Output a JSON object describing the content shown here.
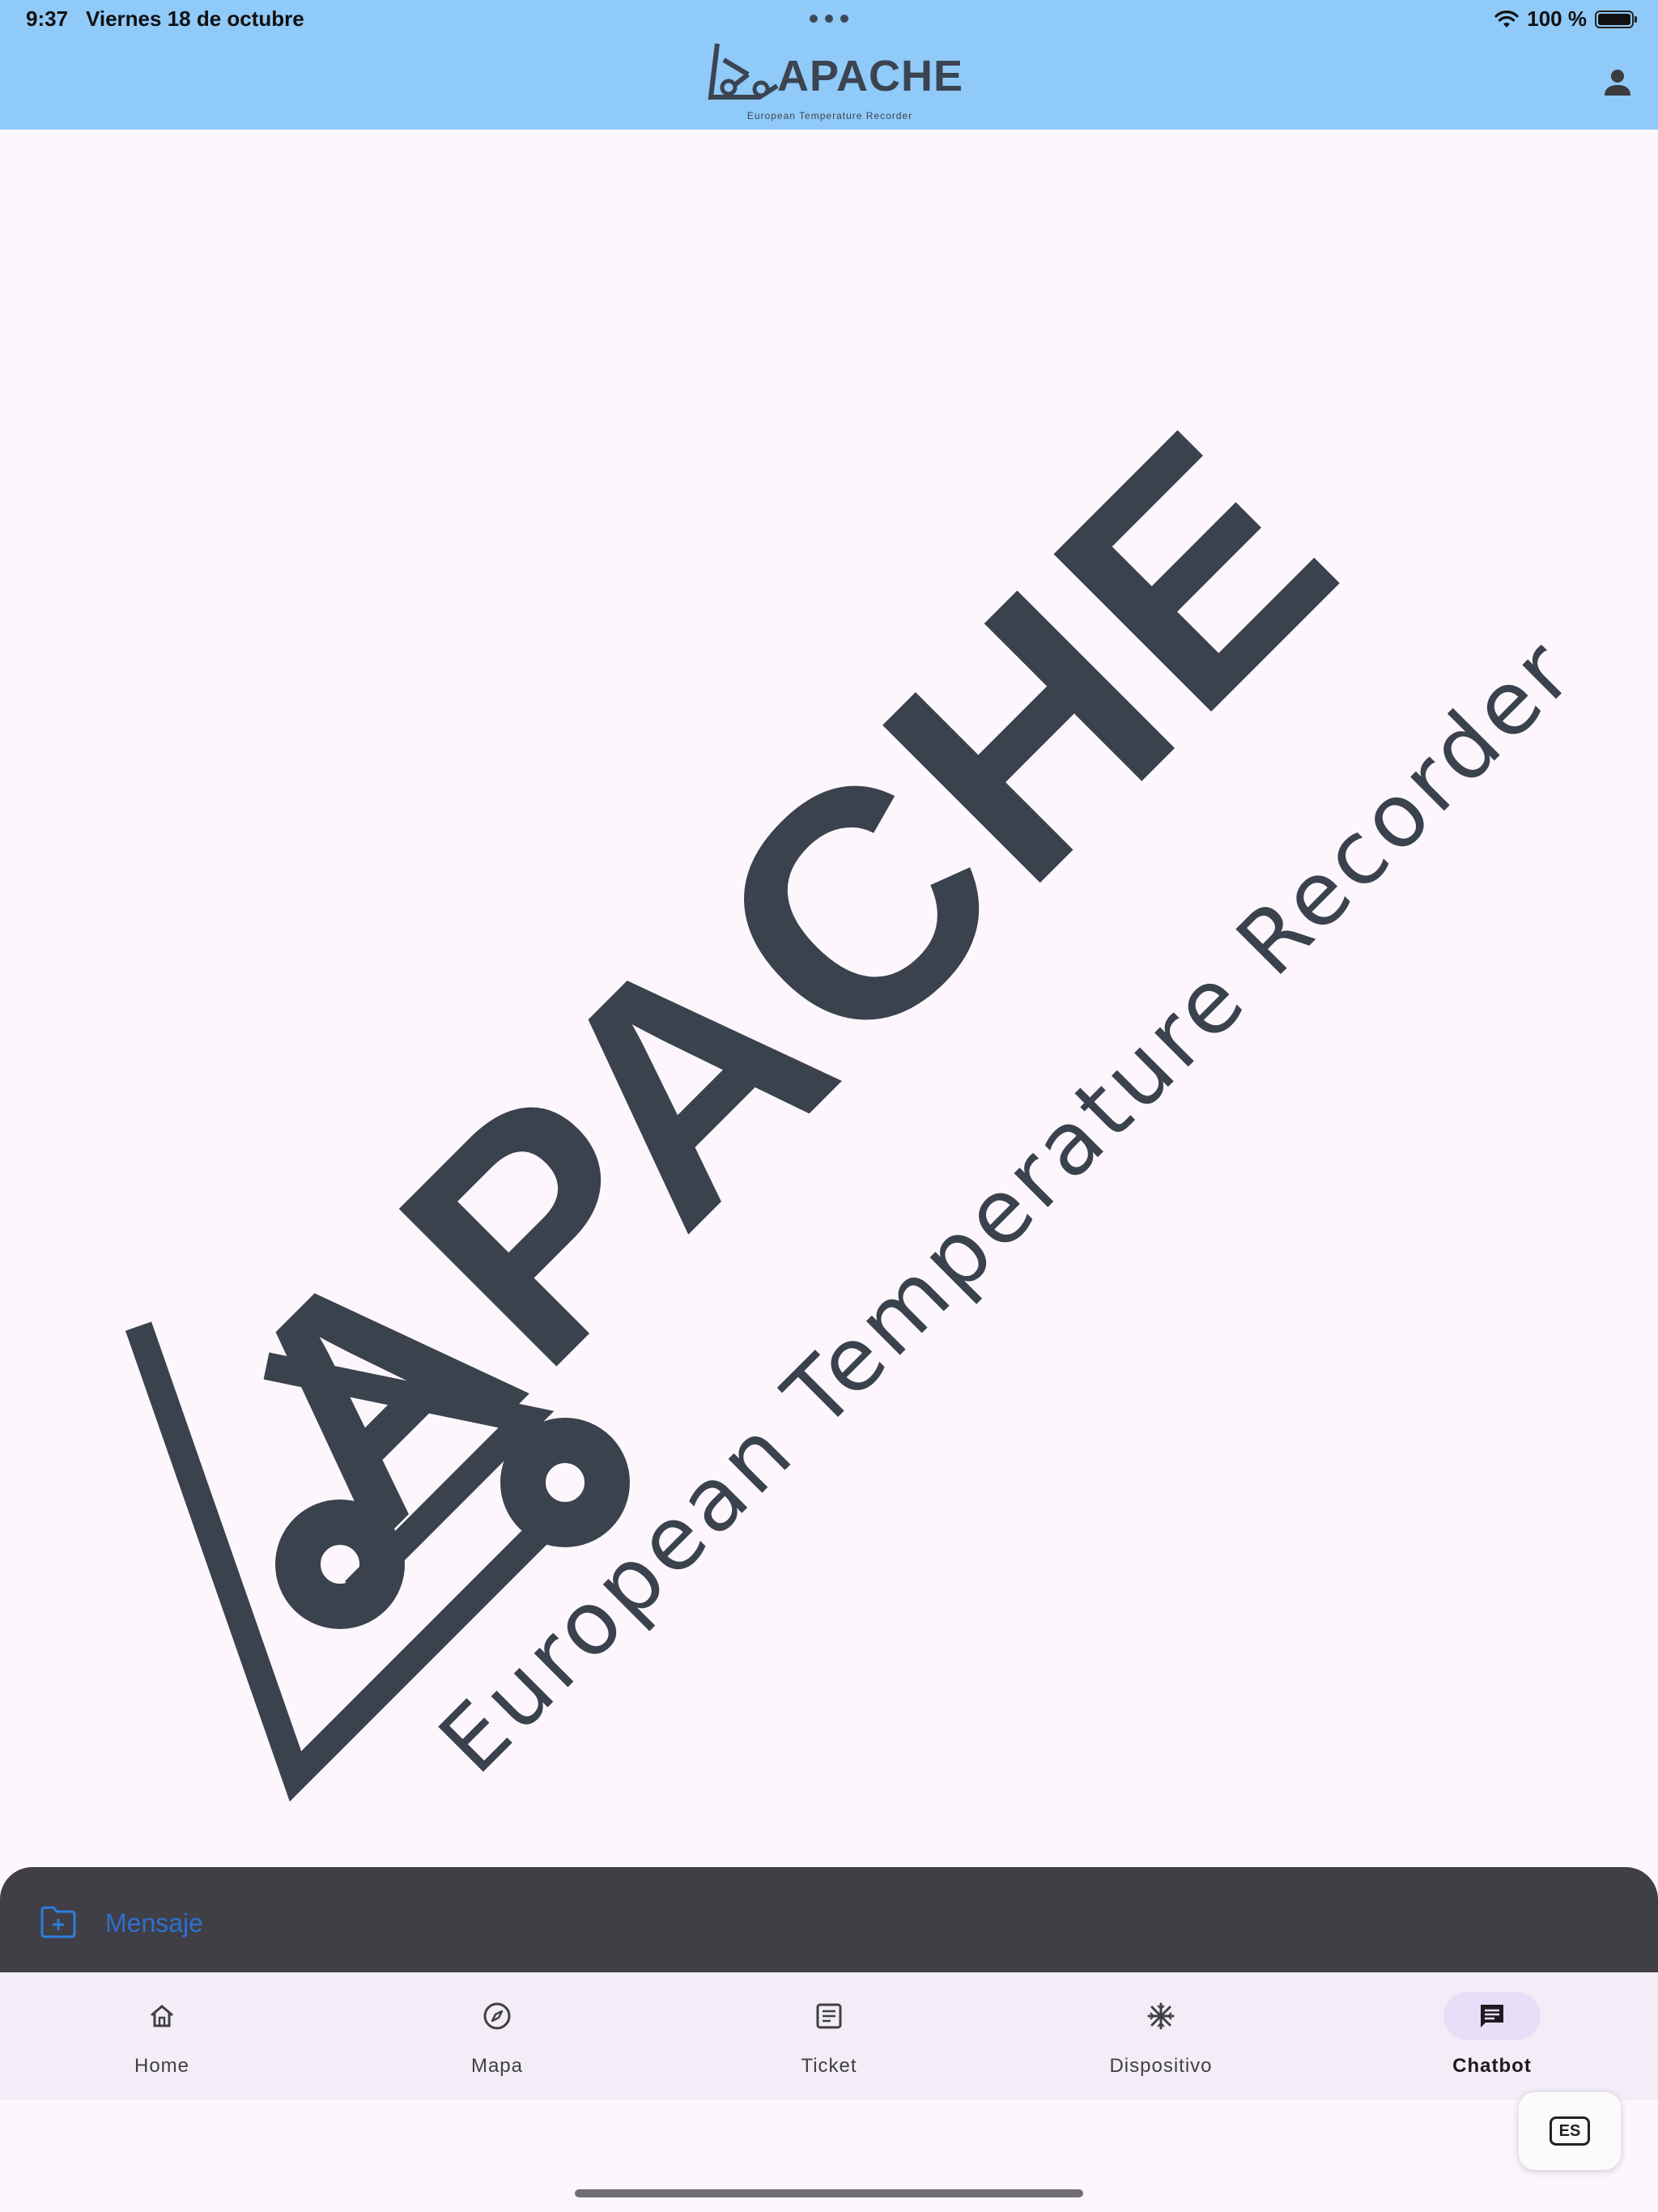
{
  "status_bar": {
    "time": "9:37",
    "date": "Viernes 18 de octubre",
    "battery": "100 %"
  },
  "header": {
    "logo_text": "APACHE",
    "logo_subtitle": "European Temperature Recorder",
    "logo_color": "#3b4450",
    "background": "#90caf9",
    "profile_icon": "person-icon"
  },
  "main": {
    "logo_text": "APACHE",
    "logo_subtitle": "European Temperature Recorder"
  },
  "message_bar": {
    "placeholder": "Mensaje",
    "attach_icon": "folder-plus-icon"
  },
  "bottom_nav": {
    "items": [
      {
        "label": "Home",
        "icon": "home-icon"
      },
      {
        "label": "Mapa",
        "icon": "compass-icon"
      },
      {
        "label": "Ticket",
        "icon": "ticket-icon"
      },
      {
        "label": "Dispositivo",
        "icon": "snowflake-icon"
      },
      {
        "label": "Chatbot",
        "icon": "chat-icon"
      }
    ],
    "active": "Chatbot"
  },
  "language_button": {
    "label": "ES"
  }
}
